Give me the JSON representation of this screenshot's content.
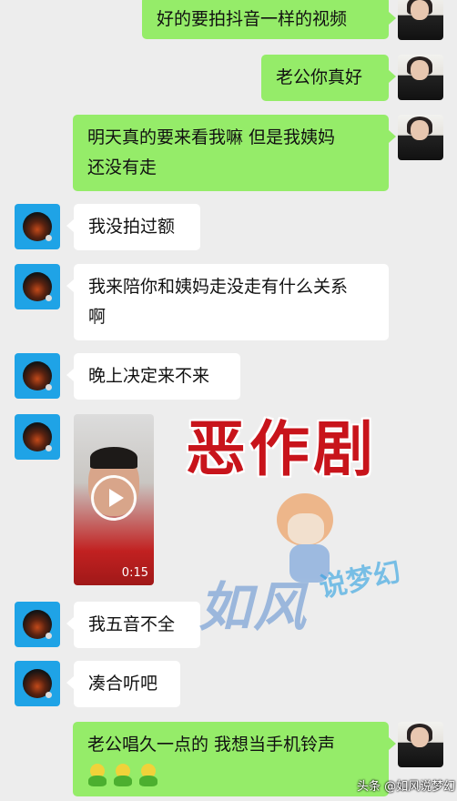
{
  "messages": [
    {
      "side": "right",
      "text": "好的要拍抖音一样的视频"
    },
    {
      "side": "right",
      "text": "老公你真好"
    },
    {
      "side": "right",
      "line1": "明天真的要来看我嘛 但是我姨妈",
      "line2": "还没有走"
    },
    {
      "side": "left",
      "text": "我没拍过额"
    },
    {
      "side": "left",
      "line1": "我来陪你和姨妈走没走有什么关系",
      "line2": "啊"
    },
    {
      "side": "left",
      "text": "晚上决定来不来"
    },
    {
      "side": "left",
      "type": "video",
      "duration": "0:15"
    },
    {
      "side": "left",
      "text": "我五音不全"
    },
    {
      "side": "left",
      "text": "凑合听吧"
    },
    {
      "side": "right",
      "line1": "老公唱久一点的 我想当手机铃声",
      "emoji_count": 3
    }
  ],
  "overlay": {
    "title": "恶作剧",
    "watermark_main": "如风",
    "watermark_sub": "说梦幻"
  },
  "footer": {
    "source": "头条 @如风说梦幻"
  },
  "colors": {
    "sent_bubble": "#95ec69",
    "received_bubble": "#ffffff",
    "background": "#ededed",
    "title_red": "#c8141b"
  }
}
